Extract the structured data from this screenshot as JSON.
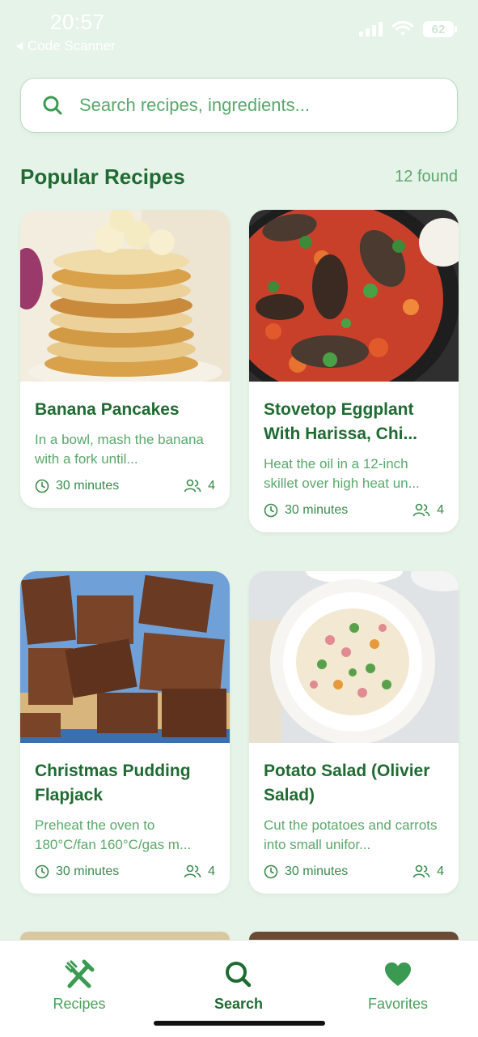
{
  "status": {
    "time": "20:57",
    "back_app": "Code Scanner",
    "battery": "62"
  },
  "search": {
    "placeholder": "Search recipes, ingredients..."
  },
  "section": {
    "title": "Popular Recipes",
    "count": "12 found"
  },
  "recipes": [
    {
      "title": "Banana Pancakes",
      "description": "In a bowl, mash the banana with a fork until...",
      "time": "30 minutes",
      "servings": "4"
    },
    {
      "title": "Stovetop Eggplant With Harissa, Chi...",
      "description": "Heat the oil in a 12-inch skillet over high heat un...",
      "time": "30 minutes",
      "servings": "4"
    },
    {
      "title": "Christmas Pudding Flapjack",
      "description": "Preheat the oven to 180°C/fan 160°C/gas m...",
      "time": "30 minutes",
      "servings": "4"
    },
    {
      "title": "Potato Salad (Olivier Salad)",
      "description": "Cut the potatoes and carrots into small unifor...",
      "time": "30 minutes",
      "servings": "4"
    }
  ],
  "nav": {
    "items": [
      {
        "label": "Recipes",
        "icon": "fork-knife-icon"
      },
      {
        "label": "Search",
        "icon": "search-icon"
      },
      {
        "label": "Favorites",
        "icon": "heart-icon"
      }
    ],
    "active": "Search"
  },
  "colors": {
    "accent": "#1f6b32",
    "accent_light": "#5aa86b",
    "background": "#e6f3e8"
  }
}
